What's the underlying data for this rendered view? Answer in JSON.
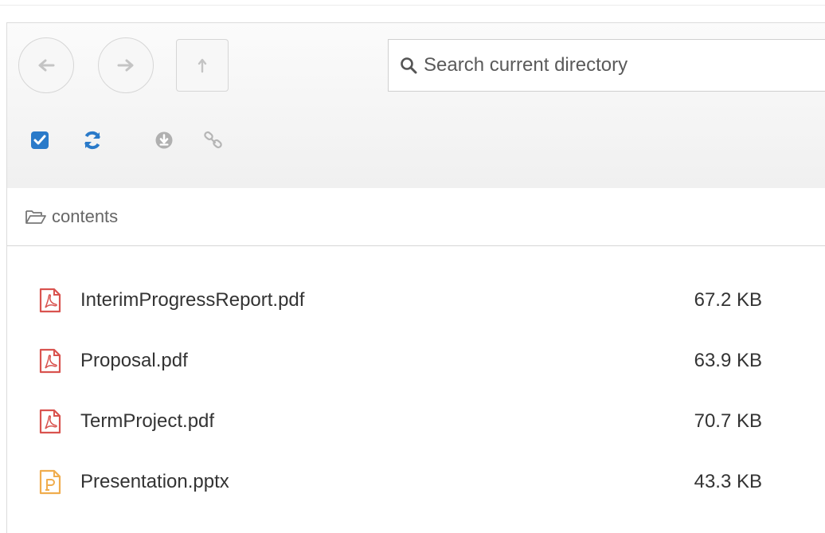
{
  "toolbar": {
    "back_icon": "arrow-left-icon",
    "forward_icon": "arrow-right-icon",
    "up_icon": "arrow-up-icon",
    "search": {
      "placeholder": "Search current directory",
      "value": ""
    },
    "tools": [
      "checkbox-icon",
      "refresh-icon",
      "download-icon",
      "link-icon"
    ]
  },
  "breadcrumb": {
    "icon": "folder-open-icon",
    "label": "contents"
  },
  "files": [
    {
      "name": "InterimProgressReport.pdf",
      "size": "67.2 KB",
      "type": "pdf"
    },
    {
      "name": "Proposal.pdf",
      "size": "63.9 KB",
      "type": "pdf"
    },
    {
      "name": "TermProject.pdf",
      "size": "70.7 KB",
      "type": "pdf"
    },
    {
      "name": "Presentation.pptx",
      "size": "43.3 KB",
      "type": "pptx"
    }
  ],
  "colors": {
    "accent": "#2a7ac9",
    "pdf": "#d9534f",
    "pptx": "#f0ad4e"
  }
}
